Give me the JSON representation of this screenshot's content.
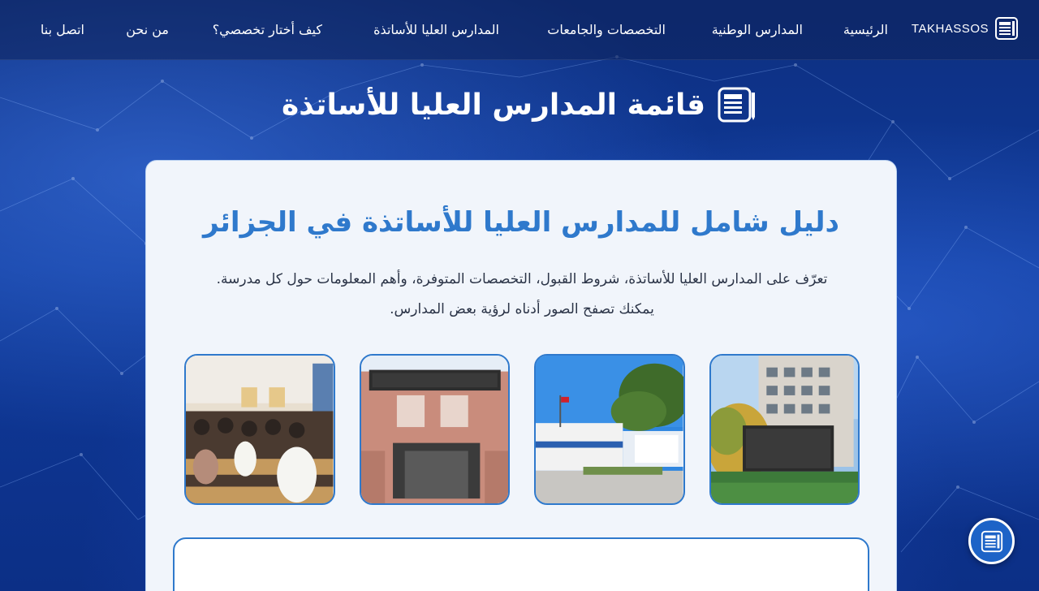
{
  "brand": {
    "name": "TAKHASSOS"
  },
  "nav": {
    "items": [
      {
        "label": "الرئيسية"
      },
      {
        "label": "المدارس الوطنية"
      },
      {
        "label": "التخصصات والجامعات"
      },
      {
        "label": "المدارس العليا للأساتذة"
      },
      {
        "label": "كيف أختار تخصصي؟"
      },
      {
        "label": "من نحن"
      },
      {
        "label": "اتصل بنا"
      }
    ]
  },
  "page": {
    "title": "قائمة المدارس العليا للأساتذة"
  },
  "card": {
    "heading": "دليل شامل للمدارس العليا للأساتذة في الجزائر",
    "desc_line1": "تعرّف على المدارس العليا للأساتذة، شروط القبول، التخصصات المتوفرة، وأهم المعلومات حول كل مدرسة.",
    "desc_line2": "يمكنك تصفح الصور أدناه لرؤية بعض المدارس."
  },
  "colors": {
    "accent": "#2f79cc",
    "nav_bg": "#0f235a",
    "card_bg": "#f1f5fb"
  },
  "icons": {
    "brand": "book-logo-icon",
    "fab": "book-logo-icon"
  }
}
